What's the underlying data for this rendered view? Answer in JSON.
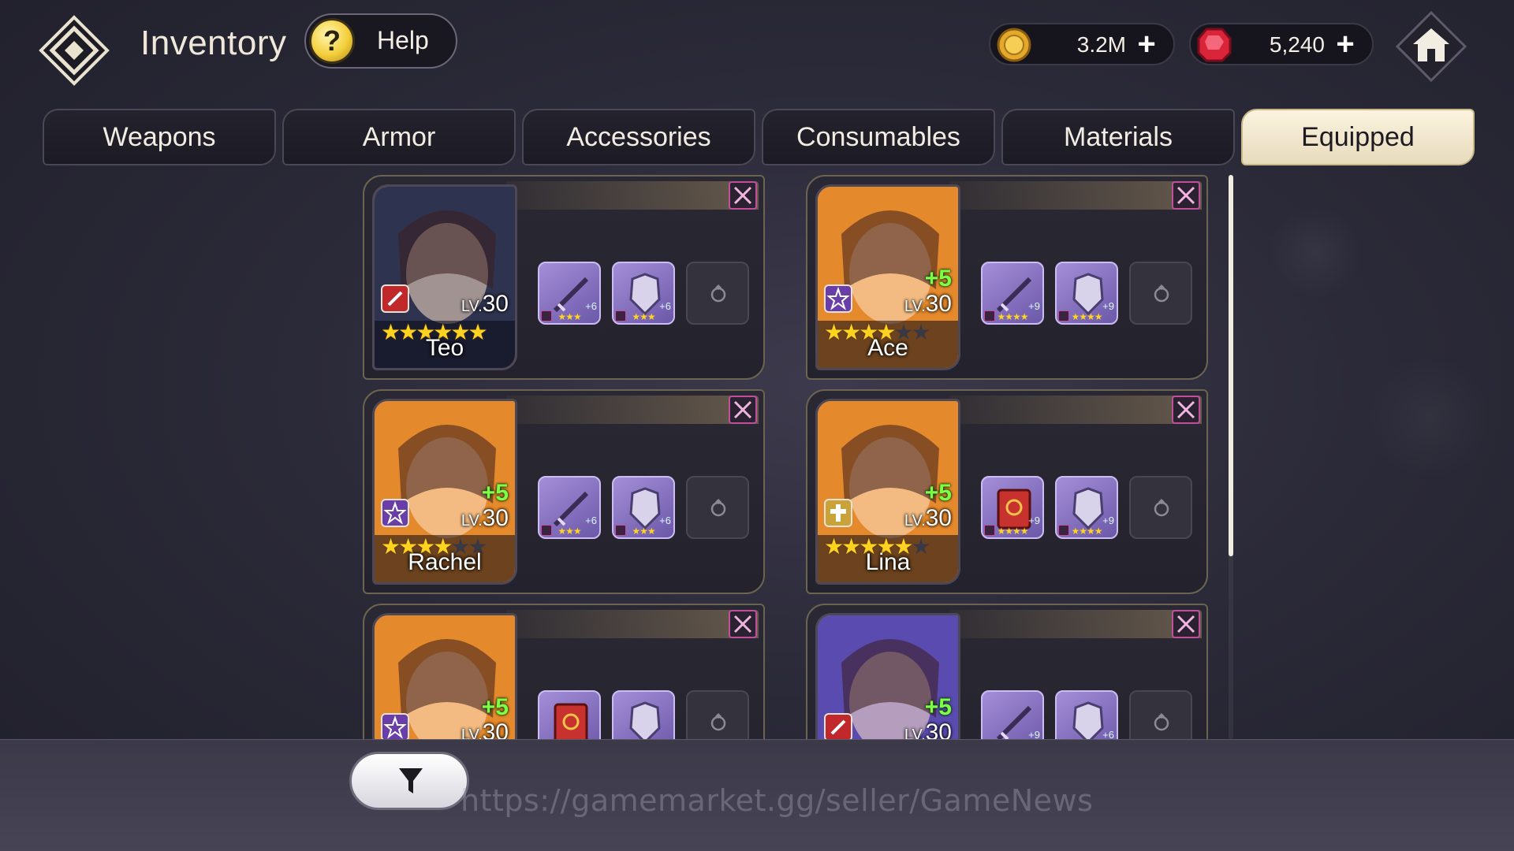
{
  "header": {
    "title": "Inventory",
    "help_label": "Help",
    "help_icon": "?",
    "gold_amount": "3.2M",
    "gem_amount": "5,240",
    "plus_symbol": "+"
  },
  "tabs": [
    {
      "label": "Weapons",
      "active": false
    },
    {
      "label": "Armor",
      "active": false
    },
    {
      "label": "Accessories",
      "active": false
    },
    {
      "label": "Consumables",
      "active": false
    },
    {
      "label": "Materials",
      "active": false
    },
    {
      "label": "Equipped",
      "active": true
    }
  ],
  "heroes": [
    {
      "name": "Teo",
      "level": "30",
      "level_prefix": "LV.",
      "enhance": "",
      "stars": 6,
      "max_stars": 6,
      "class_icon": "sword-class-icon",
      "class_color": "#c0282c",
      "portrait_color": "#2e3450",
      "weapon": {
        "icon": "sword-icon",
        "enh": "+6",
        "stars": "★★★"
      },
      "armor": {
        "icon": "armor-icon",
        "enh": "+6",
        "stars": "★★★"
      }
    },
    {
      "name": "Ace",
      "level": "30",
      "level_prefix": "LV.",
      "enhance": "+5",
      "stars": 4,
      "max_stars": 6,
      "class_icon": "star-class-icon",
      "class_color": "#6a3ea8",
      "portrait_color": "#e58a2c",
      "weapon": {
        "icon": "sword-icon",
        "enh": "+9",
        "stars": "★★★★"
      },
      "armor": {
        "icon": "armor-icon",
        "enh": "+9",
        "stars": "★★★★"
      }
    },
    {
      "name": "Rachel",
      "level": "30",
      "level_prefix": "LV.",
      "enhance": "+5",
      "stars": 4,
      "max_stars": 6,
      "class_icon": "star-class-icon",
      "class_color": "#6a3ea8",
      "portrait_color": "#e58a2c",
      "weapon": {
        "icon": "sword-icon",
        "enh": "+6",
        "stars": "★★★"
      },
      "armor": {
        "icon": "armor-icon",
        "enh": "+6",
        "stars": "★★★"
      }
    },
    {
      "name": "Lina",
      "level": "30",
      "level_prefix": "LV.",
      "enhance": "+5",
      "stars": 5,
      "max_stars": 6,
      "class_icon": "cross-class-icon",
      "class_color": "#c9a23a",
      "portrait_color": "#e58a2c",
      "weapon": {
        "icon": "tome-icon",
        "enh": "+9",
        "stars": "★★★★"
      },
      "armor": {
        "icon": "armor-icon",
        "enh": "+9",
        "stars": "★★★★"
      }
    },
    {
      "name": "",
      "level": "30",
      "level_prefix": "LV.",
      "enhance": "+5",
      "stars": 0,
      "max_stars": 0,
      "class_icon": "star-class-icon",
      "class_color": "#6a3ea8",
      "portrait_color": "#e58a2c",
      "weapon": {
        "icon": "tome-icon",
        "enh": "",
        "stars": ""
      },
      "armor": {
        "icon": "armor-icon",
        "enh": "",
        "stars": ""
      }
    },
    {
      "name": "",
      "level": "30",
      "level_prefix": "LV.",
      "enhance": "+5",
      "stars": 0,
      "max_stars": 0,
      "class_icon": "sword-class-icon",
      "class_color": "#c0282c",
      "portrait_color": "#5a4bb0",
      "weapon": {
        "icon": "sword-icon",
        "enh": "+9",
        "stars": ""
      },
      "armor": {
        "icon": "armor-icon",
        "enh": "+6",
        "stars": ""
      }
    }
  ],
  "watermark": "https://gamemarket.gg/seller/GameNews",
  "colors": {
    "accent_gold": "#f4cf3d",
    "active_tab": "#fbf3df",
    "gem_red": "#d9243a",
    "enhance_green": "#7dff47"
  }
}
